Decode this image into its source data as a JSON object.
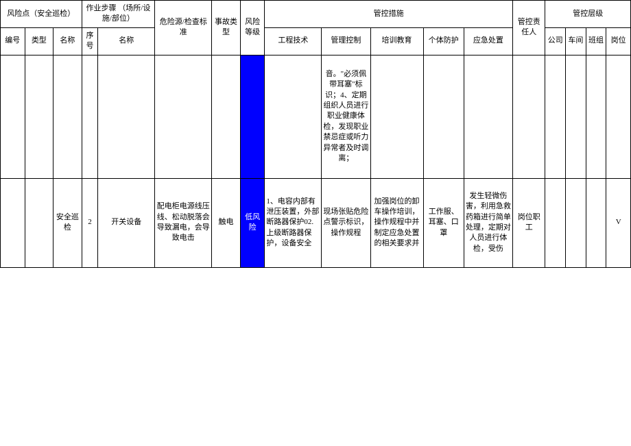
{
  "headers": {
    "riskPoint": "风险点（安全巡检）",
    "workStep": "作业步骤\n（场所/设施/部位）",
    "hazardStd": "危险源/检查标准",
    "accidentType": "事故类型",
    "riskLevel": "风险等级",
    "controlMeasure": "管控措施",
    "controlResp": "管控责任人",
    "controlLevel": "管控层级",
    "id": "编号",
    "type": "类型",
    "name": "名称",
    "seq": "序号",
    "stepName": "名称",
    "engineering": "工程技术",
    "mgmtControl": "管理控制",
    "training": "培训教育",
    "ppe": "个体防护",
    "emergency": "应急处置",
    "company": "公司",
    "workshop": "车间",
    "team": "班组",
    "post": "岗位"
  },
  "rows": [
    {
      "id": "",
      "type": "",
      "name": "",
      "seq": "",
      "stepName": "",
      "hazard": "",
      "accident": "",
      "riskLevel": "",
      "engineering": "",
      "mgmtControl": "音。\"必须佩带耳塞\"标识；4、定期组织人员进行职业健康体检，发现职业禁忌症或听力异常者及时调离；",
      "training": "",
      "ppe": "",
      "emergency": "",
      "responsible": "",
      "company": "",
      "workshop": "",
      "team": "",
      "post": ""
    },
    {
      "id": "",
      "type": "",
      "name": "安全巡检",
      "seq": "2",
      "stepName": "开关设备",
      "hazard": "配电柜电源线压线、松动脱落会导致漏电，会导致电击",
      "accident": "触电",
      "riskLevel": "低风险",
      "engineering": "1、电容内部有泄压装置，外部断路器保护02.上级断路器保护，设备安全",
      "mgmtControl": "现场张贴危险点警示标识，操作规程",
      "training": "加强岗位的卸车操作培训，操作规程中并制定应急处置的相关要求并",
      "ppe": "工作服、耳塞、口罩",
      "emergency": "发生轻微伤害，利用急救药箱进行简单处理，定期对人员进行体检，受伤",
      "responsible": "岗位职工",
      "company": "",
      "workshop": "",
      "team": "",
      "post": "V"
    }
  ]
}
